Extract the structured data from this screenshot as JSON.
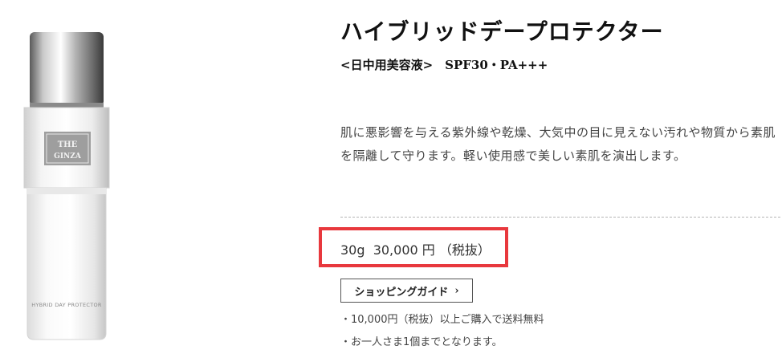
{
  "product": {
    "name": "ハイブリッドデープロテクター",
    "subtitle": "<日中用美容液>　SPF30・PA+++",
    "description": "肌に悪影響を与える紫外線や乾燥、大気中の目に見えない汚れや物質から素肌を隔離して守ります。軽い使用感で美しい素肌を演出します。",
    "price": "30g  30,000 円 （税抜）",
    "bottle_logo": "THE GINZA",
    "bottle_label": "HYBRID DAY PROTECTOR"
  },
  "shopping_guide": {
    "label": "ショッピングガイド",
    "arrow": "›"
  },
  "notes": [
    "・10,000円（税抜）以上ご購入で送料無料",
    "・お一人さま1個までとなります。"
  ],
  "colors": {
    "highlight_border": "#e8383d"
  },
  "icons": {
    "guide_arrow": "chevron-right-icon"
  }
}
